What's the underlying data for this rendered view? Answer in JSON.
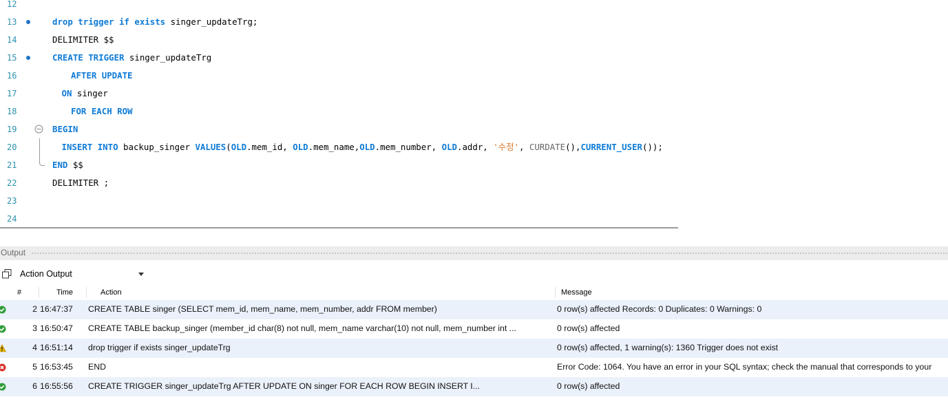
{
  "editor": {
    "lines": [
      {
        "n": "12",
        "marker": false,
        "indent": 0,
        "tokens": []
      },
      {
        "n": "13",
        "marker": true,
        "indent": 0,
        "tokens": [
          {
            "t": "kw",
            "v": "drop trigger if exists "
          },
          {
            "t": "id",
            "v": "singer_updateTrg;"
          }
        ]
      },
      {
        "n": "14",
        "marker": false,
        "indent": 0,
        "tokens": [
          {
            "t": "id",
            "v": "DELIMITER $$"
          }
        ]
      },
      {
        "n": "15",
        "marker": true,
        "indent": 0,
        "tokens": [
          {
            "t": "kw",
            "v": "CREATE TRIGGER "
          },
          {
            "t": "id",
            "v": "singer_updateTrg"
          }
        ]
      },
      {
        "n": "16",
        "marker": false,
        "indent": 2,
        "tokens": [
          {
            "t": "kw",
            "v": "AFTER UPDATE"
          }
        ]
      },
      {
        "n": "17",
        "marker": false,
        "indent": 1,
        "tokens": [
          {
            "t": "kw",
            "v": "ON "
          },
          {
            "t": "id",
            "v": "singer"
          }
        ]
      },
      {
        "n": "18",
        "marker": false,
        "indent": 2,
        "tokens": [
          {
            "t": "kw",
            "v": "FOR EACH ROW"
          }
        ]
      },
      {
        "n": "19",
        "marker": false,
        "indent": 0,
        "fold": "open",
        "tokens": [
          {
            "t": "kw",
            "v": "BEGIN"
          }
        ]
      },
      {
        "n": "20",
        "marker": false,
        "indent": 1,
        "fold": "line",
        "tokens": [
          {
            "t": "kw",
            "v": "INSERT INTO "
          },
          {
            "t": "id",
            "v": "backup_singer "
          },
          {
            "t": "kw",
            "v": "VALUES"
          },
          {
            "t": "id",
            "v": "("
          },
          {
            "t": "kw",
            "v": "OLD"
          },
          {
            "t": "id",
            "v": ".mem_id, "
          },
          {
            "t": "kw",
            "v": "OLD"
          },
          {
            "t": "id",
            "v": ".mem_name,"
          },
          {
            "t": "kw",
            "v": "OLD"
          },
          {
            "t": "id",
            "v": ".mem_number, "
          },
          {
            "t": "kw",
            "v": "OLD"
          },
          {
            "t": "id",
            "v": ".addr, "
          },
          {
            "t": "str",
            "v": "'수정'"
          },
          {
            "t": "id",
            "v": ", "
          },
          {
            "t": "fn",
            "v": "CURDATE"
          },
          {
            "t": "id",
            "v": "(),"
          },
          {
            "t": "kw",
            "v": "CURRENT_USER"
          },
          {
            "t": "id",
            "v": "());"
          }
        ]
      },
      {
        "n": "21",
        "marker": false,
        "indent": 0,
        "fold": "end",
        "tokens": [
          {
            "t": "kw",
            "v": "END "
          },
          {
            "t": "id",
            "v": "$$"
          }
        ]
      },
      {
        "n": "22",
        "marker": false,
        "indent": 0,
        "tokens": [
          {
            "t": "id",
            "v": "DELIMITER ;"
          }
        ]
      },
      {
        "n": "23",
        "marker": false,
        "indent": 0,
        "tokens": []
      },
      {
        "n": "24",
        "marker": false,
        "indent": 0,
        "tokens": []
      }
    ]
  },
  "output": {
    "title": "Output",
    "select_value": "Action Output",
    "columns": {
      "num": "#",
      "time": "Time",
      "action": "Action",
      "message": "Message"
    },
    "rows": [
      {
        "status": "ok",
        "num": "2",
        "time": "16:47:37",
        "action": "CREATE TABLE singer (SELECT mem_id, mem_name, mem_number, addr FROM member)",
        "message": "0 row(s) affected Records: 0  Duplicates: 0  Warnings: 0"
      },
      {
        "status": "ok",
        "num": "3",
        "time": "16:50:47",
        "action": "CREATE TABLE backup_singer (member_id char(8) not null, mem_name varchar(10) not null, mem_number int ...",
        "message": "0 row(s) affected"
      },
      {
        "status": "warn",
        "num": "4",
        "time": "16:51:14",
        "action": "drop trigger if exists singer_updateTrg",
        "message": "0 row(s) affected, 1 warning(s): 1360 Trigger does not exist"
      },
      {
        "status": "error",
        "num": "5",
        "time": "16:53:45",
        "action": "END",
        "message": "Error Code: 1064. You have an error in your SQL syntax; check the manual that corresponds to your"
      },
      {
        "status": "ok",
        "num": "6",
        "time": "16:55:56",
        "action": "CREATE TRIGGER singer_updateTrg     AFTER UPDATE    ON singer    FOR EACH ROW BEGIN   INSERT I...",
        "message": "0 row(s) affected"
      }
    ]
  },
  "colors": {
    "keyword": "#0f7bd6",
    "line_number": "#2b91af",
    "string": "#d8782d",
    "ok": "#2e9e3a",
    "warn": "#e8b400",
    "error": "#d9302c"
  },
  "icons": {
    "ok": "check-circle-icon",
    "warn": "warning-triangle-icon",
    "error": "error-x-circle-icon",
    "copy": "copy-icon",
    "select": "chevron-down-icon"
  }
}
